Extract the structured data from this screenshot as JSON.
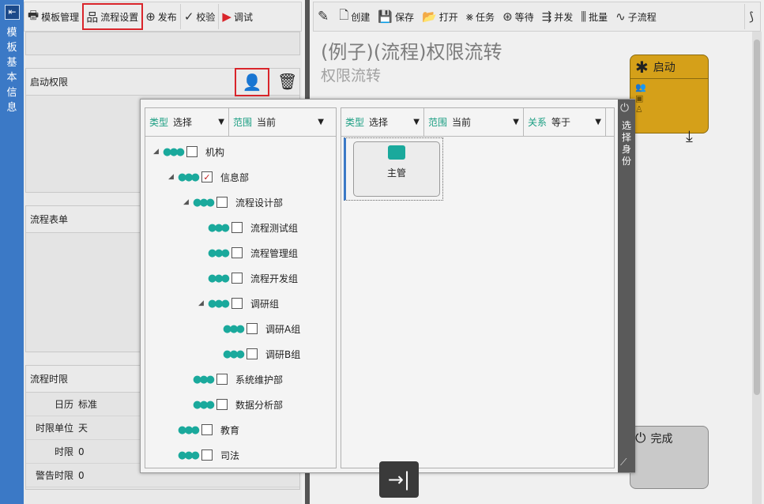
{
  "left_strip": {
    "title": "模板基本信息"
  },
  "left_toolbar": [
    {
      "label": "模板管理",
      "icon": "printer-icon"
    },
    {
      "label": "流程设置",
      "icon": "sitemap-icon"
    },
    {
      "label": "发布",
      "icon": "globe-icon"
    },
    {
      "label": "校验",
      "icon": "check-icon"
    },
    {
      "label": "调试",
      "icon": "play-icon"
    }
  ],
  "sections": {
    "start_perm": "启动权限",
    "flow_form": "流程表单",
    "flow_limit": "流程时限"
  },
  "limit_rows": [
    {
      "key": "日历",
      "value": "标准"
    },
    {
      "key": "时限单位",
      "value": "天"
    },
    {
      "key": "时限",
      "value": "0"
    },
    {
      "key": "警告时限",
      "value": "0"
    }
  ],
  "right_toolbar": [
    {
      "label": "",
      "icon": "pencil-icon"
    },
    {
      "label": "创建",
      "icon": "new-file-icon"
    },
    {
      "label": "保存",
      "icon": "save-icon"
    },
    {
      "label": "打开",
      "icon": "folder-icon"
    },
    {
      "label": "任务",
      "icon": "task-icon"
    },
    {
      "label": "等待",
      "icon": "wait-icon"
    },
    {
      "label": "并发",
      "icon": "fork-icon"
    },
    {
      "label": "批量",
      "icon": "batch-icon"
    },
    {
      "label": "子流程",
      "icon": "subflow-icon"
    }
  ],
  "process": {
    "title": "(例子)(流程)权限流转",
    "subtitle": "权限流转"
  },
  "nodes": {
    "start": "启动",
    "end": "完成"
  },
  "modal": {
    "side_title": "选择身份",
    "left_filters": [
      {
        "label": "类型",
        "value": "选择"
      },
      {
        "label": "范围",
        "value": "当前"
      }
    ],
    "right_filters": [
      {
        "label": "类型",
        "value": "选择"
      },
      {
        "label": "范围",
        "value": "当前"
      },
      {
        "label": "关系",
        "value": "等于"
      }
    ],
    "tree": [
      {
        "label": "机构",
        "level": 0,
        "expanded": true,
        "checked": false
      },
      {
        "label": "信息部",
        "level": 1,
        "expanded": true,
        "checked": true
      },
      {
        "label": "流程设计部",
        "level": 2,
        "expanded": true,
        "checked": false
      },
      {
        "label": "流程测试组",
        "level": 3,
        "expanded": null,
        "checked": false
      },
      {
        "label": "流程管理组",
        "level": 3,
        "expanded": null,
        "checked": false
      },
      {
        "label": "流程开发组",
        "level": 3,
        "expanded": null,
        "checked": false
      },
      {
        "label": "调研组",
        "level": 3,
        "expanded": true,
        "checked": false
      },
      {
        "label": "调研A组",
        "level": 4,
        "expanded": null,
        "checked": false
      },
      {
        "label": "调研B组",
        "level": 4,
        "expanded": null,
        "checked": false
      },
      {
        "label": "系统维护部",
        "level": 2,
        "expanded": null,
        "checked": false
      },
      {
        "label": "数据分析部",
        "level": 2,
        "expanded": null,
        "checked": false
      },
      {
        "label": "教育",
        "level": 1,
        "expanded": null,
        "checked": false
      },
      {
        "label": "司法",
        "level": 1,
        "expanded": null,
        "checked": false
      }
    ],
    "selected_card": "主管"
  },
  "colors": {
    "accent": "#3b79c6",
    "teal": "#1aa99c",
    "start": "#d5a019",
    "highlight": "#d9252b"
  }
}
